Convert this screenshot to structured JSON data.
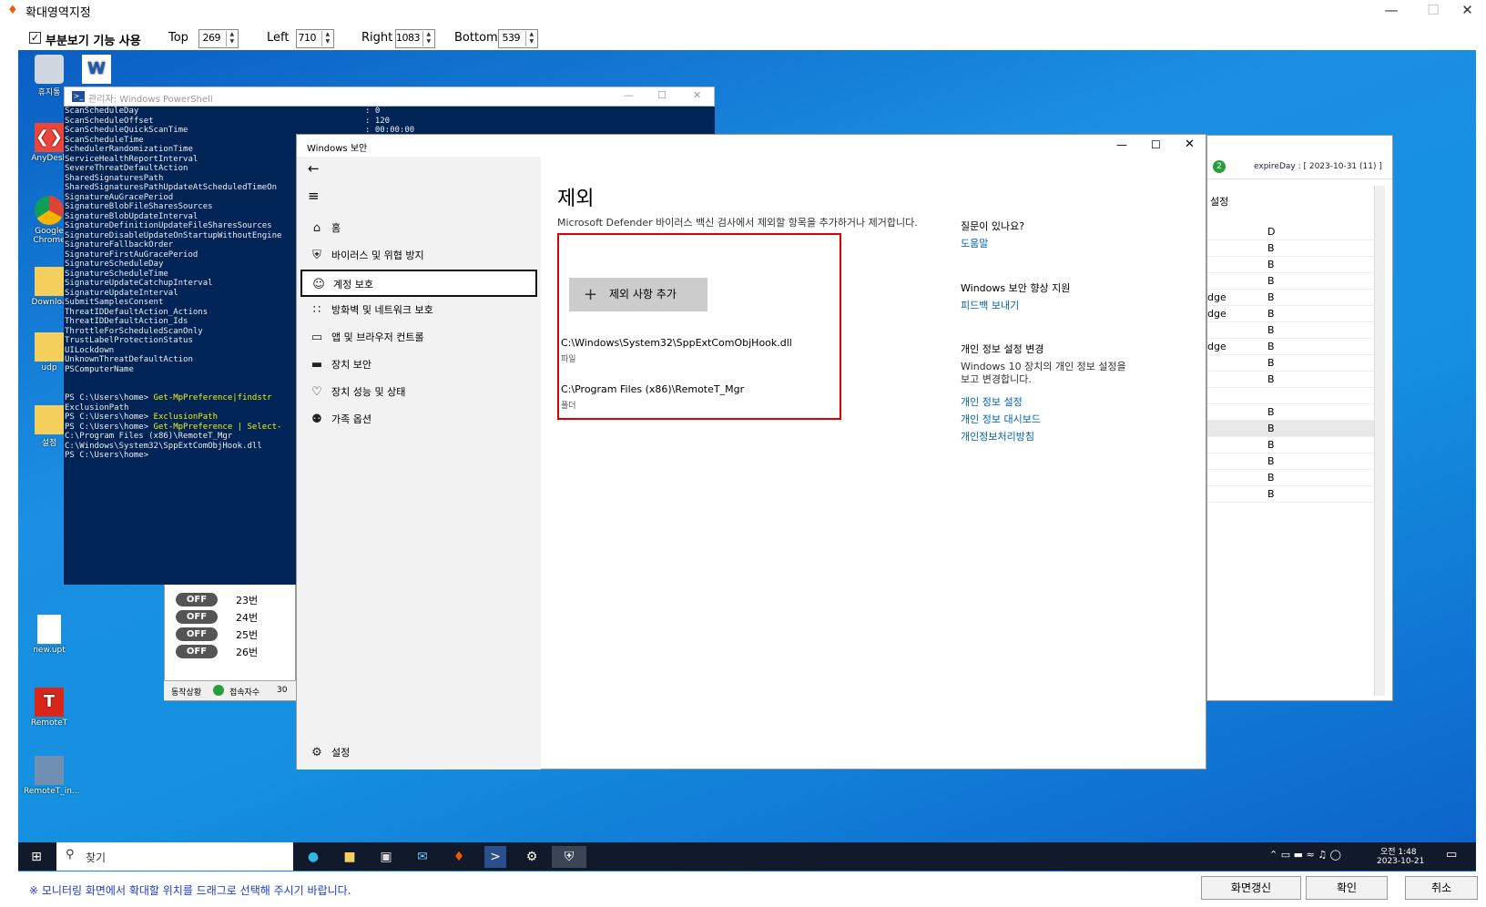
{
  "app": {
    "title": "확대영역지정",
    "partial_view_label": "부분보기 기능 사용",
    "partial_view_checked": true,
    "fields": [
      {
        "label": "Top",
        "value": "269"
      },
      {
        "label": "Left",
        "value": "710"
      },
      {
        "label": "Right",
        "value": "1083"
      },
      {
        "label": "Bottom",
        "value": "539"
      }
    ],
    "hint": "※ 모니터링 화면에서 확대할 위치를 드래그로 선택해 주시기 바랍니다.",
    "buttons": {
      "refresh": "화면갱신",
      "ok": "확인",
      "cancel": "취소"
    }
  },
  "desktop_icons": [
    {
      "label": "휴지통",
      "icon": "recycle-bin-icon"
    },
    {
      "label": "AnyDesk",
      "icon": "anydesk-icon"
    },
    {
      "label": "Google Chrome",
      "icon": "chrome-icon"
    },
    {
      "label": "Downloa",
      "icon": "folder-icon"
    },
    {
      "label": "udp",
      "icon": "folder-icon"
    },
    {
      "label": "설정",
      "icon": "folder-icon"
    },
    {
      "label": "new.upt",
      "icon": "file-icon"
    },
    {
      "label": "RemoteT",
      "icon": "remotet-icon"
    },
    {
      "label": "RemoteT_in...",
      "icon": "installer-icon"
    }
  ],
  "powershell": {
    "title": "관리자: Windows PowerShell",
    "lines": [
      {
        "k": "ScanScheduleDay",
        "v": ": 0"
      },
      {
        "k": "ScanScheduleOffset",
        "v": ": 120"
      },
      {
        "k": "ScanScheduleQuickScanTime",
        "v": ": 00:00:00"
      },
      {
        "k": "ScanScheduleTime",
        "v": ""
      },
      {
        "k": "SchedulerRandomizationTime",
        "v": ""
      },
      {
        "k": "ServiceHealthReportInterval",
        "v": ""
      },
      {
        "k": "SevereThreatDefaultAction",
        "v": ""
      },
      {
        "k": "SharedSignaturesPath",
        "v": ""
      },
      {
        "k": "SharedSignaturesPathUpdateAtScheduledTimeOn",
        "v": ""
      },
      {
        "k": "SignatureAuGracePeriod",
        "v": ""
      },
      {
        "k": "SignatureBlobFileSharesSources",
        "v": ""
      },
      {
        "k": "SignatureBlobUpdateInterval",
        "v": ""
      },
      {
        "k": "SignatureDefinitionUpdateFileSharesSources",
        "v": ""
      },
      {
        "k": "SignatureDisableUpdateOnStartupWithoutEngine",
        "v": ""
      },
      {
        "k": "SignatureFallbackOrder",
        "v": ""
      },
      {
        "k": "SignatureFirstAuGracePeriod",
        "v": ""
      },
      {
        "k": "SignatureScheduleDay",
        "v": ""
      },
      {
        "k": "SignatureScheduleTime",
        "v": ""
      },
      {
        "k": "SignatureUpdateCatchupInterval",
        "v": ""
      },
      {
        "k": "SignatureUpdateInterval",
        "v": ""
      },
      {
        "k": "SubmitSamplesConsent",
        "v": ""
      },
      {
        "k": "ThreatIDDefaultAction_Actions",
        "v": ""
      },
      {
        "k": "ThreatIDDefaultAction_Ids",
        "v": ""
      },
      {
        "k": "ThrottleForScheduledScanOnly",
        "v": ""
      },
      {
        "k": "TrustLabelProtectionStatus",
        "v": ""
      },
      {
        "k": "UILockdown",
        "v": ""
      },
      {
        "k": "UnknownThreatDefaultAction",
        "v": ""
      },
      {
        "k": "PSComputerName",
        "v": ""
      }
    ],
    "cmd_lines": [
      {
        "p": "PS C:\\Users\\home> ",
        "c": "Get-MpPreference|findstr"
      },
      {
        "p": "ExclusionPath",
        "c": ""
      },
      {
        "p": "PS C:\\Users\\home> ",
        "c": "ExclusionPath"
      },
      {
        "p": "PS C:\\Users\\home> ",
        "c": "Get-MpPreference | Select-"
      },
      {
        "p": "C:\\Program Files (x86)\\RemoteT_Mgr",
        "c": ""
      },
      {
        "p": "C:\\Windows\\System32\\SppExtComObjHook.dll",
        "c": ""
      },
      {
        "p": "PS C:\\Users\\home>",
        "c": ""
      }
    ]
  },
  "off_list": {
    "toggle_label": "OFF",
    "items": [
      "23번",
      "24번",
      "25번",
      "26번"
    ],
    "status": [
      "동작상황",
      "접속자수",
      "30"
    ]
  },
  "right_window": {
    "expire": "expireDay : [ 2023-10-31 (11) ]",
    "badge": "2",
    "col_header": "설정",
    "rows": [
      {
        "a": "",
        "b": "D"
      },
      {
        "a": "",
        "b": "B"
      },
      {
        "a": "",
        "b": "B"
      },
      {
        "a": "",
        "b": "B"
      },
      {
        "a": "dge",
        "b": "B"
      },
      {
        "a": "dge",
        "b": "B"
      },
      {
        "a": "",
        "b": "B"
      },
      {
        "a": "dge",
        "b": "B"
      },
      {
        "a": "",
        "b": "B"
      },
      {
        "a": "",
        "b": "B"
      },
      {
        "a": "",
        "b": ""
      },
      {
        "a": "",
        "b": "B"
      },
      {
        "a": "",
        "b": "B"
      },
      {
        "a": "",
        "b": "B"
      },
      {
        "a": "",
        "b": "B"
      },
      {
        "a": "",
        "b": "B"
      },
      {
        "a": "",
        "b": "B"
      }
    ]
  },
  "security": {
    "title": "Windows 보안",
    "nav": [
      {
        "label": "홈",
        "icon": "home-icon"
      },
      {
        "label": "바이러스 및 위협 방지",
        "icon": "shield-icon"
      },
      {
        "label": "계정 보호",
        "icon": "person-icon"
      },
      {
        "label": "방화벽 및 네트워크 보호",
        "icon": "wifi-icon"
      },
      {
        "label": "앱 및 브라우저 컨트롤",
        "icon": "app-window-icon"
      },
      {
        "label": "장치 보안",
        "icon": "laptop-icon"
      },
      {
        "label": "장치 성능 및 상태",
        "icon": "heart-icon"
      },
      {
        "label": "가족 옵션",
        "icon": "family-icon"
      }
    ],
    "settings_label": "설정",
    "heading": "제외",
    "description": "Microsoft Defender 바이러스 백신 검사에서 제외할 항목을 추가하거나 제거합니다.",
    "add_button": "제외 사항 추가",
    "exclusions": [
      {
        "path": "C:\\Windows\\System32\\SppExtComObjHook.dll",
        "type": "파일"
      },
      {
        "path": "C:\\Program Files (x86)\\RemoteT_Mgr",
        "type": "폴더"
      }
    ],
    "side": {
      "q_title": "질문이 있나요?",
      "help": "도움말",
      "improve_title": "Windows 보안 향상 지원",
      "feedback": "피드백 보내기",
      "privacy_title": "개인 정보 설정 변경",
      "privacy_desc": "Windows 10 장치의 개인 정보 설정을 보고 변경합니다.",
      "links": [
        "개인 정보 설정",
        "개인 정보 대시보드",
        "개인정보처리방침"
      ]
    }
  },
  "taskbar": {
    "search_placeholder": "찾기",
    "time": "오전 1:48",
    "date": "2023-10-21"
  }
}
